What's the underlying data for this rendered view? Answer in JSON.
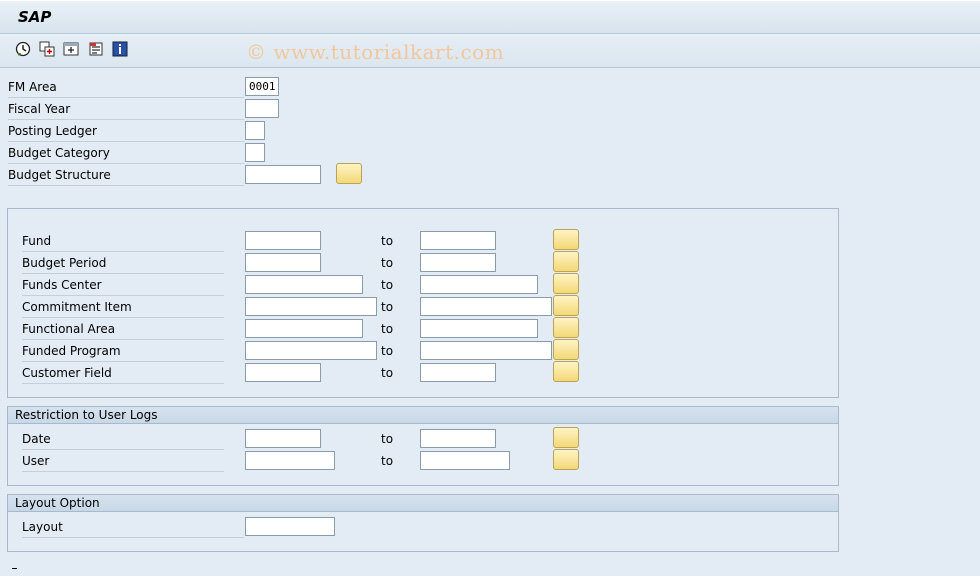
{
  "app": {
    "title": "SAP",
    "watermark": "© www.tutorialkart.com"
  },
  "toolbar": {
    "icons": [
      "execute-icon",
      "get-variant-icon",
      "multiple-selection-icon",
      "selection-options-icon",
      "info-icon"
    ]
  },
  "header_fields": [
    {
      "label": "FM Area",
      "value": "0001"
    },
    {
      "label": "Fiscal Year",
      "value": ""
    },
    {
      "label": "Posting Ledger",
      "value": ""
    },
    {
      "label": "Budget Category",
      "value": ""
    },
    {
      "label": "Budget Structure",
      "value": ""
    }
  ],
  "range_fields": [
    {
      "label": "Fund",
      "from": "",
      "to_label": "to",
      "to": ""
    },
    {
      "label": "Budget Period",
      "from": "",
      "to_label": "to",
      "to": ""
    },
    {
      "label": "Funds Center",
      "from": "",
      "to_label": "to",
      "to": ""
    },
    {
      "label": "Commitment Item",
      "from": "",
      "to_label": "to",
      "to": ""
    },
    {
      "label": "Functional Area",
      "from": "",
      "to_label": "to",
      "to": ""
    },
    {
      "label": "Funded Program",
      "from": "",
      "to_label": "to",
      "to": ""
    },
    {
      "label": "Customer Field",
      "from": "",
      "to_label": "to",
      "to": ""
    }
  ],
  "user_logs": {
    "title": "Restriction to User Logs",
    "fields": [
      {
        "label": "Date",
        "from": "",
        "to_label": "to",
        "to": ""
      },
      {
        "label": "User",
        "from": "",
        "to_label": "to",
        "to": ""
      }
    ]
  },
  "layout_option": {
    "title": "Layout Option",
    "fields": [
      {
        "label": "Layout",
        "value": ""
      }
    ]
  },
  "colors": {
    "background": "#e3ecf4",
    "watermark": "#f3c79b",
    "multi_select_button": "#f3d977"
  }
}
